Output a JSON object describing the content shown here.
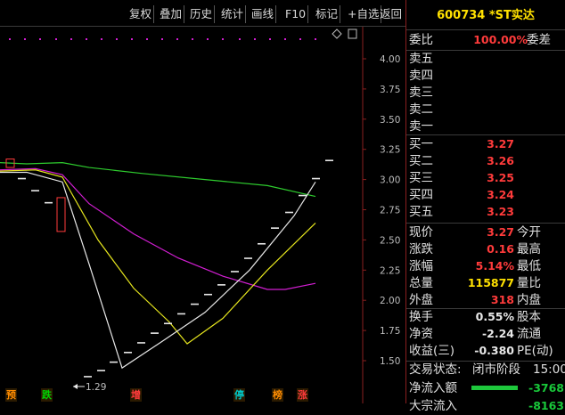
{
  "toolbar": {
    "buttons": [
      "复权",
      "叠加",
      "历史",
      "统计",
      "画线",
      "F10",
      "标记",
      "+自选",
      "返回"
    ]
  },
  "stock": {
    "code": "600734",
    "name": "*ST实达",
    "title": "600734 *ST实达"
  },
  "order_book": {
    "ratio_label": "委比",
    "ratio_value": "100.00%",
    "diff_label": "委差",
    "sell": [
      {
        "label": "卖五",
        "price": ""
      },
      {
        "label": "卖四",
        "price": ""
      },
      {
        "label": "卖三",
        "price": ""
      },
      {
        "label": "卖二",
        "price": ""
      },
      {
        "label": "卖一",
        "price": ""
      }
    ],
    "buy": [
      {
        "label": "买一",
        "price": "3.27"
      },
      {
        "label": "买二",
        "price": "3.26"
      },
      {
        "label": "买三",
        "price": "3.25"
      },
      {
        "label": "买四",
        "price": "3.24"
      },
      {
        "label": "买五",
        "price": "3.23"
      }
    ]
  },
  "quote": {
    "rows": [
      {
        "l": "现价",
        "v": "3.27",
        "r": "今开",
        "color": "#ff3b3b"
      },
      {
        "l": "涨跌",
        "v": "0.16",
        "r": "最高",
        "color": "#ff3b3b"
      },
      {
        "l": "涨幅",
        "v": "5.14%",
        "r": "最低",
        "color": "#ff3b3b"
      },
      {
        "l": "总量",
        "v": "115877",
        "r": "量比",
        "color": "#ffe100"
      },
      {
        "l": "外盘",
        "v": "318",
        "r": "内盘",
        "color": "#ff3b3b"
      }
    ],
    "rows2": [
      {
        "l": "换手",
        "v": "0.55%",
        "r": "股本",
        "color": "#e8e8e8"
      },
      {
        "l": "净资",
        "v": "-2.24",
        "r": "流通",
        "color": "#e8e8e8"
      },
      {
        "l": "收益(三)",
        "v": "-0.380",
        "r": "PE(动)",
        "color": "#e8e8e8"
      }
    ],
    "status_label": "交易状态:",
    "status_value": "闭市阶段",
    "time": "15:00",
    "net_inflow_label": "净流入额",
    "net_inflow_value": "-3768",
    "big_inflow_label": "大宗流入",
    "big_inflow_value": "-8163"
  },
  "chart_data": {
    "type": "line",
    "ylim": [
      1.4,
      4.1
    ],
    "y_ticks": [
      "4.00",
      "3.75",
      "3.50",
      "3.25",
      "3.00",
      "2.75",
      "2.50",
      "2.25",
      "2.00",
      "1.75",
      "1.50"
    ],
    "low_annotation": "1.29",
    "signals": [
      {
        "text": "预",
        "color": "#ff8c00"
      },
      {
        "text": "跌",
        "color": "#00d200"
      },
      {
        "text": "增",
        "color": "#ff3b3b"
      },
      {
        "text": "停",
        "color": "#00c8c8"
      },
      {
        "text": "榜",
        "color": "#ff8c00"
      },
      {
        "text": "涨",
        "color": "#ff3b3b"
      }
    ],
    "colors": {
      "green": "#2ecc2e",
      "magenta": "#d21ed2",
      "yellow": "#e6e61e",
      "white": "#e8e8e8",
      "up": "#ff3b3b",
      "dots": "#d21ed2"
    }
  }
}
